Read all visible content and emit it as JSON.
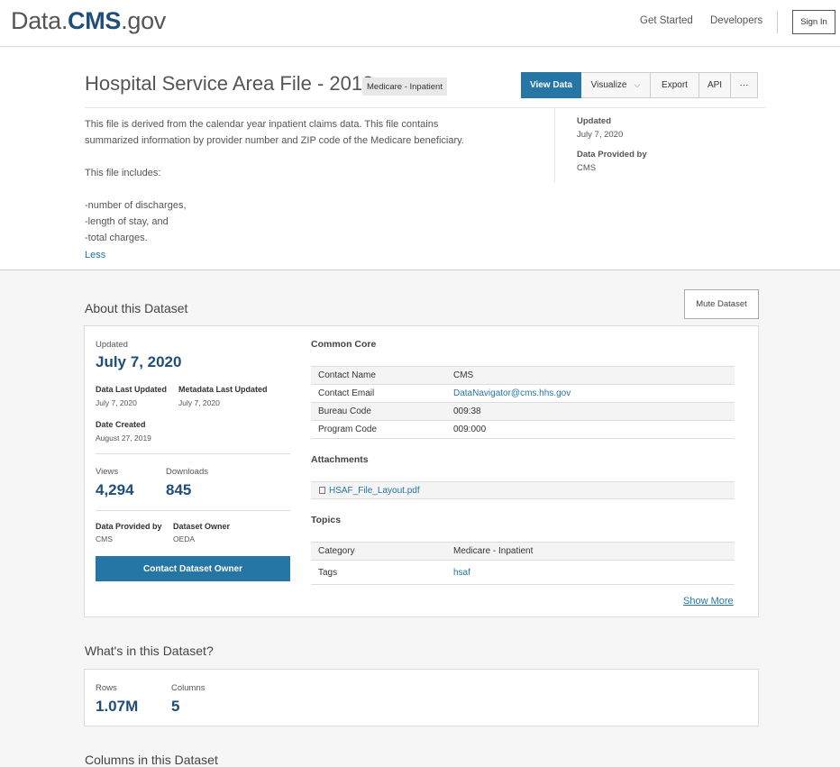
{
  "header": {
    "logo_prefix": "Data.",
    "logo_brand": "CMS",
    "logo_suffix": ".gov",
    "nav": [
      "Get Started",
      "Developers"
    ],
    "sign_in": "Sign In"
  },
  "dataset": {
    "title": "Hospital Service Area File - 2018",
    "category_pill": "Medicare - Inpatient",
    "actions": {
      "view_data": "View Data",
      "visualize": "Visualize",
      "export": "Export",
      "api": "API",
      "more": "···"
    },
    "description": {
      "p1": "This file is derived from the calendar year inpatient claims data. This file contains",
      "p2": "summarized information by provider number and ZIP code of the Medicare beneficiary.",
      "p3": "This file includes:",
      "l1": "-number of discharges,",
      "l2": "-length of stay, and",
      "l3": "-total charges."
    },
    "less_link": "Less",
    "side_meta": {
      "updated_label": "Updated",
      "updated_value": "July 7, 2020",
      "provided_label": "Data Provided by",
      "provided_value": "CMS"
    }
  },
  "about": {
    "heading": "About this Dataset",
    "mute_button": "Mute Dataset",
    "updated_label": "Updated",
    "updated_value": "July 7, 2020",
    "data_last_updated_label": "Data Last Updated",
    "data_last_updated_value": "July 7, 2020",
    "metadata_last_updated_label": "Metadata Last Updated",
    "metadata_last_updated_value": "July 7, 2020",
    "date_created_label": "Date Created",
    "date_created_value": "August 27, 2019",
    "views_label": "Views",
    "views_value": "4,294",
    "downloads_label": "Downloads",
    "downloads_value": "845",
    "provided_label": "Data Provided by",
    "provided_value": "CMS",
    "owner_label": "Dataset Owner",
    "owner_value": "OEDA",
    "contact_button": "Contact Dataset Owner",
    "common_core": {
      "heading": "Common Core",
      "rows": [
        {
          "key": "Contact Name",
          "value": "CMS"
        },
        {
          "key": "Contact Email",
          "value": "DataNavigator@cms.hhs.gov"
        },
        {
          "key": "Bureau Code",
          "value": "009:38"
        },
        {
          "key": "Program Code",
          "value": "009:000"
        }
      ]
    },
    "attachments": {
      "heading": "Attachments",
      "file": "HSAF_File_Layout.pdf"
    },
    "topics": {
      "heading": "Topics",
      "rows": [
        {
          "key": "Category",
          "value": "Medicare - Inpatient"
        },
        {
          "key": "Tags",
          "value": "hsaf"
        }
      ]
    },
    "show_more": "Show More"
  },
  "whats_in": {
    "heading": "What's in this Dataset?",
    "rows_label": "Rows",
    "rows_value": "1.07M",
    "columns_label": "Columns",
    "columns_value": "5"
  },
  "columns_section": {
    "heading": "Columns in this Dataset"
  },
  "colors": {
    "brand_blue": "#1f4e79",
    "action_blue": "#2576a4",
    "link_blue": "#2576a4"
  }
}
